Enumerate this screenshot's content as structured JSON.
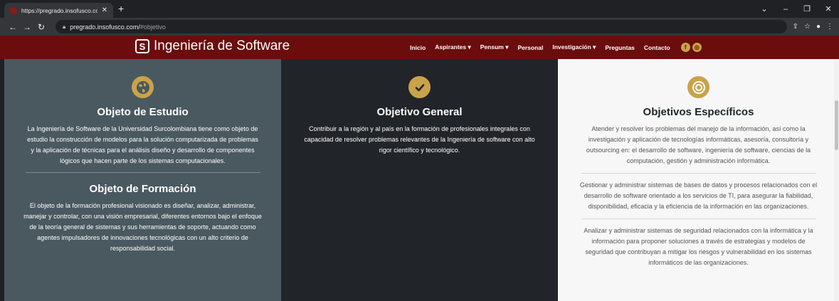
{
  "browser": {
    "tab_title": "https://pregrado.insofusco.com/",
    "url_host": "pregrado.insofusco.com/",
    "url_hash": "#objetivo"
  },
  "site": {
    "brand": "Ingeniería de Software",
    "logo_letter": "S",
    "menu": [
      "Inicio",
      "Aspirantes ▾",
      "Pensum ▾",
      "Personal",
      "Investigación ▾",
      "Preguntas",
      "Contacto"
    ],
    "social": [
      "f",
      "◎"
    ]
  },
  "sections": {
    "estudio": {
      "title": "Objeto de Estudio",
      "text": "La Ingeniería de Software de la Universidad Surcolombiana tiene como objeto de estudio la construcción de modelos para la solución computarizada de problemas y la aplicación de técnicas para el análisis diseño y desarrollo de componentes lógicos que hacen parte de los sistemas computacionales."
    },
    "formacion": {
      "title": "Objeto de Formación",
      "text": "El objeto de la formación profesional visionado es diseñar, analizar, administrar, manejar y controlar, con una visión empresarial, diferentes entornos bajo el enfoque de la teoría general de sistemas y sus herramientas de soporte, actuando como agentes impulsadores de innovaciones tecnológicas con un alto criterio de responsabilidad social."
    },
    "general": {
      "title": "Objetivo General",
      "text": "Contribuir a la región y al país en la formación de profesionales integrales con capacidad de resolver problemas relevantes de la Ingeniería de software con alto rigor científico y tecnológico."
    },
    "especificos": {
      "title": "Objetivos Específicos",
      "items": [
        "Atender y resolver los problemas del manejo de la información, así como la investigación y aplicación de tecnologías informáticas, asesoría, consultoría y outsourcing en: el desarrollo de software, ingeniería de software, ciencias de la computación, gestión y administración informática.",
        "Gestionar y administrar sistemas de bases de datos y procesos relacionados con el desarrollo de software orientado a los servicios de TI, para asegurar la fiabilidad, disponibilidad, eficacia y la eficiencia de la información en las organizaciones.",
        "Analizar y administrar sistemas de seguridad relacionados con la informática y la información para proponer soluciones a través de estrategias y modelos de seguridad que contribuyan a mitigar los riesgos y vulnerabilidad en los sistemas informáticos de las organizaciones."
      ]
    }
  },
  "colors": {
    "nav": "#6b0d0d",
    "accent": "#c9a34a",
    "col1": "#4a5960",
    "col2": "#212529",
    "col3": "#f7f7f7"
  }
}
